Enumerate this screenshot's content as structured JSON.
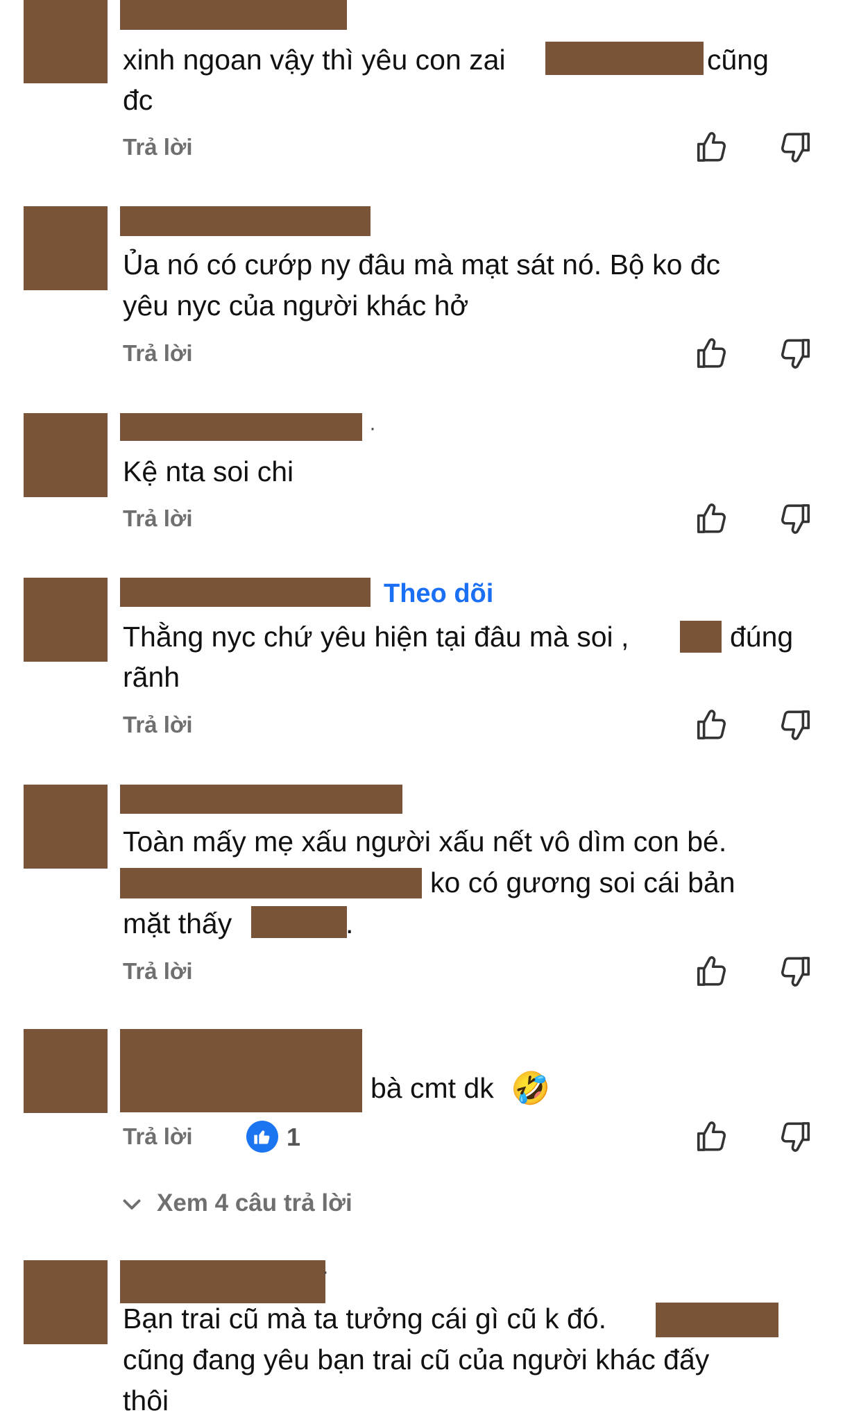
{
  "reply_label": "Trả lời",
  "follow_label": "Theo dõi",
  "comments": [
    {
      "line1": "xinh ngoan vậy thì yêu con zai",
      "line1_tail": "cũng",
      "line2": "đc"
    },
    {
      "line1": "Ủa nó có cướp ny đâu mà mạt sát nó. Bộ ko đc",
      "line2": "yêu nyc của người khác hở"
    },
    {
      "line1": "Kệ nta soi chi"
    },
    {
      "line1": "Thằng nyc chứ yêu hiện tại đâu mà soi ,",
      "line1_tail": "đúng",
      "line2": "rãnh"
    },
    {
      "line1": "Toàn mấy mẹ xấu người xấu nết vô dìm con bé.",
      "line2": "ko có gương soi cái bản",
      "line3": "mặt thấy",
      "line3_tail": "."
    },
    {
      "line1": "bà cmt dk",
      "emoji": "🤣",
      "reaction_count": "1",
      "more_replies": "Xem 4 câu trả lời"
    },
    {
      "line1": "Bạn trai cũ mà ta tưởng cái gì cũ k đó.",
      "line2": "cũng đang yêu bạn trai cũ của người khác đấy",
      "line3": "thôi"
    }
  ],
  "colors": {
    "redaction": "#7a5438",
    "link": "#1b6ff5",
    "meta": "#6f6f6f",
    "reaction": "#1b74f0"
  },
  "icons": [
    "thumbs-up-icon",
    "thumbs-down-icon",
    "like-reaction-icon",
    "chevron-down-icon",
    "rofl-emoji"
  ]
}
